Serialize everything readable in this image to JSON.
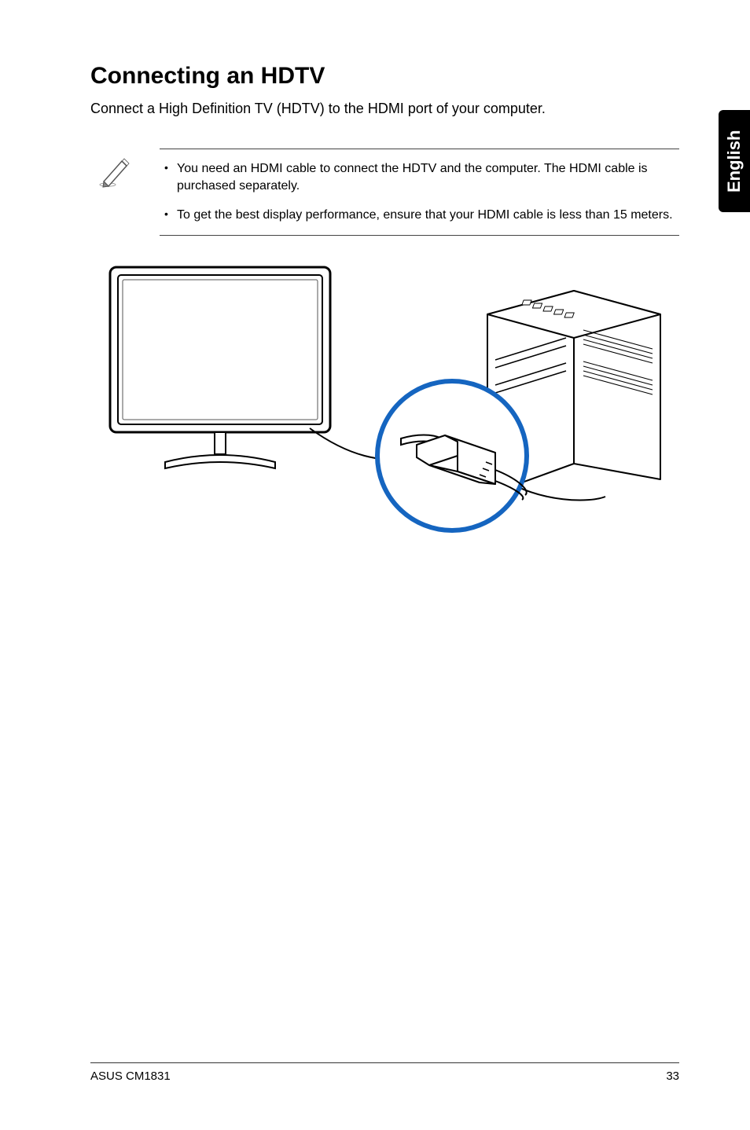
{
  "language_tab": "English",
  "heading": "Connecting an HDTV",
  "intro": "Connect a High Definition TV (HDTV) to the HDMI port of your computer.",
  "notes": [
    "You need an HDMI cable to connect the HDTV and the computer. The HDMI cable is purchased separately.",
    "To get the best display performance, ensure that your HDMI cable is less than 15 meters."
  ],
  "figure_alt": "Diagram of an HDTV connected to a desktop computer via an HDMI cable, with a magnified circular inset showing the HDMI plug entering the computer's port.",
  "footer": {
    "model": "ASUS CM1831",
    "page_number": "33"
  }
}
